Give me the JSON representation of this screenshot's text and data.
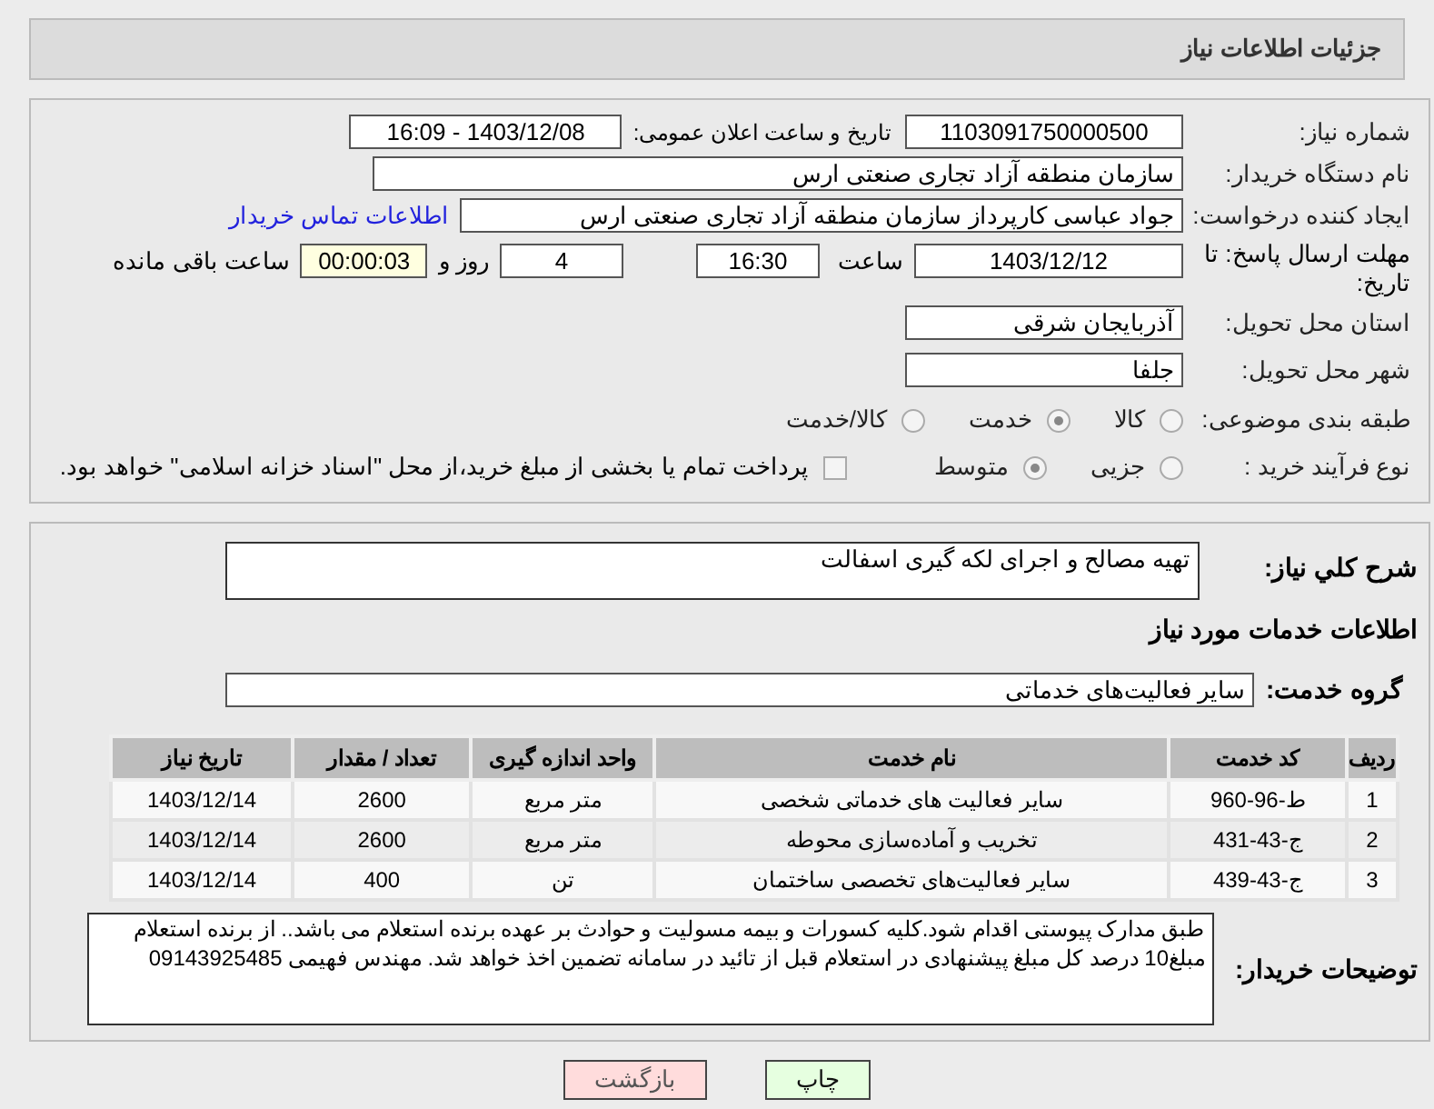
{
  "header": {
    "title": "جزئیات اطلاعات نیاز"
  },
  "need_number": {
    "label": "شماره نیاز:",
    "value": "1103091750000500"
  },
  "announce": {
    "label": "تاریخ و ساعت اعلان عمومی:",
    "value": "1403/12/08 - 16:09"
  },
  "buyer_org": {
    "label": "نام دستگاه خریدار:",
    "value": "سازمان منطقه آزاد تجاری صنعتی ارس"
  },
  "requester": {
    "label": "ایجاد کننده درخواست:",
    "value": "جواد عباسی کارپرداز سازمان منطقه آزاد تجاری صنعتی ارس",
    "link": "اطلاعات تماس خریدار"
  },
  "deadline": {
    "label": "مهلت ارسال پاسخ: تا تاریخ:",
    "date": "1403/12/12",
    "time_label": "ساعت",
    "time": "16:30",
    "days": "4",
    "days_label": "روز و",
    "remaining": "00:00:03",
    "remaining_label": "ساعت باقی مانده"
  },
  "province": {
    "label": "استان محل تحویل:",
    "value": "آذربایجان شرقی"
  },
  "city": {
    "label": "شهر محل تحویل:",
    "value": "جلفا"
  },
  "category": {
    "label": "طبقه بندی موضوعی:",
    "options": [
      {
        "label": "کالا",
        "selected": false
      },
      {
        "label": "خدمت",
        "selected": true
      },
      {
        "label": "کالا/خدمت",
        "selected": false
      }
    ]
  },
  "purchase_type": {
    "label": "نوع فرآیند خرید :",
    "options": [
      {
        "label": "جزیی",
        "selected": false
      },
      {
        "label": "متوسط",
        "selected": true
      }
    ],
    "payment": {
      "checked": false,
      "label": "پرداخت تمام یا بخشی از مبلغ خرید،از محل \"اسناد خزانه اسلامی\" خواهد بود."
    }
  },
  "summary": {
    "label": "شرح کلي نياز:",
    "value": "تهیه مصالح و اجرای لکه گیری اسفالت"
  },
  "services_title": "اطلاعات خدمات مورد نیاز",
  "service_group": {
    "label": "گروه خدمت:",
    "value": "سایر فعالیت‌های خدماتی"
  },
  "table": {
    "columns": [
      "ردیف",
      "کد خدمت",
      "نام خدمت",
      "واحد اندازه گیری",
      "تعداد / مقدار",
      "تاریخ نیاز"
    ],
    "rows": [
      [
        "1",
        "ط-96-960",
        "سایر فعالیت های خدماتی شخصی",
        "متر مربع",
        "2600",
        "1403/12/14"
      ],
      [
        "2",
        "ج-43-431",
        "تخریب و آماده‌سازی محوطه",
        "متر مربع",
        "2600",
        "1403/12/14"
      ],
      [
        "3",
        "ج-43-439",
        "سایر فعالیت‌های تخصصی ساختمان",
        "تن",
        "400",
        "1403/12/14"
      ]
    ]
  },
  "buyer_notes": {
    "label": "توضیحات خریدار:",
    "value": "طبق مدارک پیوستی اقدام شود.کلیه کسورات و بیمه مسولیت و حوادث بر عهده برنده استعلام می باشد.. از برنده استعلام مبلغ10 درصد کل مبلغ پیشنهادی در استعلام قبل از تائید در سامانه تضمین اخذ خواهد شد. مهندس فهیمی 09143925485"
  },
  "buttons": [
    {
      "kind": "print",
      "label": "چاپ"
    },
    {
      "kind": "back",
      "label": "بازگشت"
    }
  ]
}
